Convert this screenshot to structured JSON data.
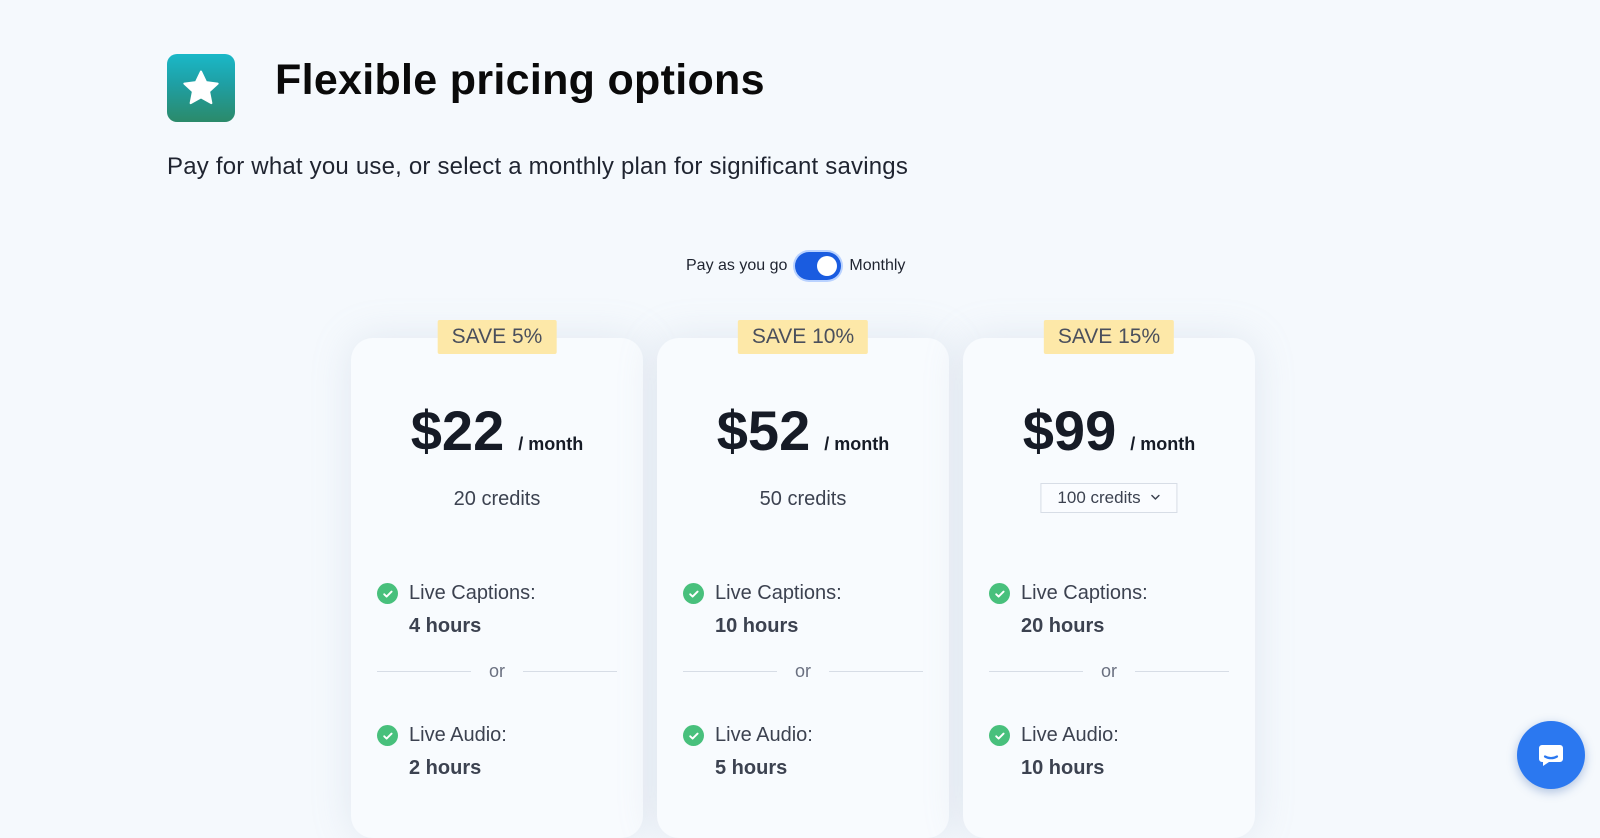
{
  "header": {
    "icon": "star-icon",
    "title": "Flexible pricing options",
    "subtitle": "Pay for what you use, or select a monthly plan for significant savings"
  },
  "billing_toggle": {
    "left_label": "Pay as you go",
    "right_label": "Monthly",
    "selected": "Monthly"
  },
  "plans": [
    {
      "badge": "SAVE 5%",
      "price": "$22",
      "period": "/ month",
      "credits": "20 credits",
      "features": [
        {
          "label": "Live Captions:",
          "value": "4 hours"
        },
        {
          "label": "Live Audio:",
          "value": "2 hours"
        }
      ],
      "divider": "or"
    },
    {
      "badge": "SAVE 10%",
      "price": "$52",
      "period": "/ month",
      "credits": "50 credits",
      "features": [
        {
          "label": "Live Captions:",
          "value": "10 hours"
        },
        {
          "label": "Live Audio:",
          "value": "5 hours"
        }
      ],
      "divider": "or"
    },
    {
      "badge": "SAVE 15%",
      "price": "$99",
      "period": "/ month",
      "credits_select": "100 credits",
      "features": [
        {
          "label": "Live Captions:",
          "value": "20 hours"
        },
        {
          "label": "Live Audio:",
          "value": "10 hours"
        }
      ],
      "divider": "or"
    }
  ],
  "chat_widget": {
    "icon": "chat-bubble-icon"
  },
  "colors": {
    "background": "#f5f9fd",
    "toggle_accent": "#1a5ce0",
    "badge_bg": "#fde8a8",
    "check": "#48c07c",
    "chat_button": "#2b78f0"
  }
}
